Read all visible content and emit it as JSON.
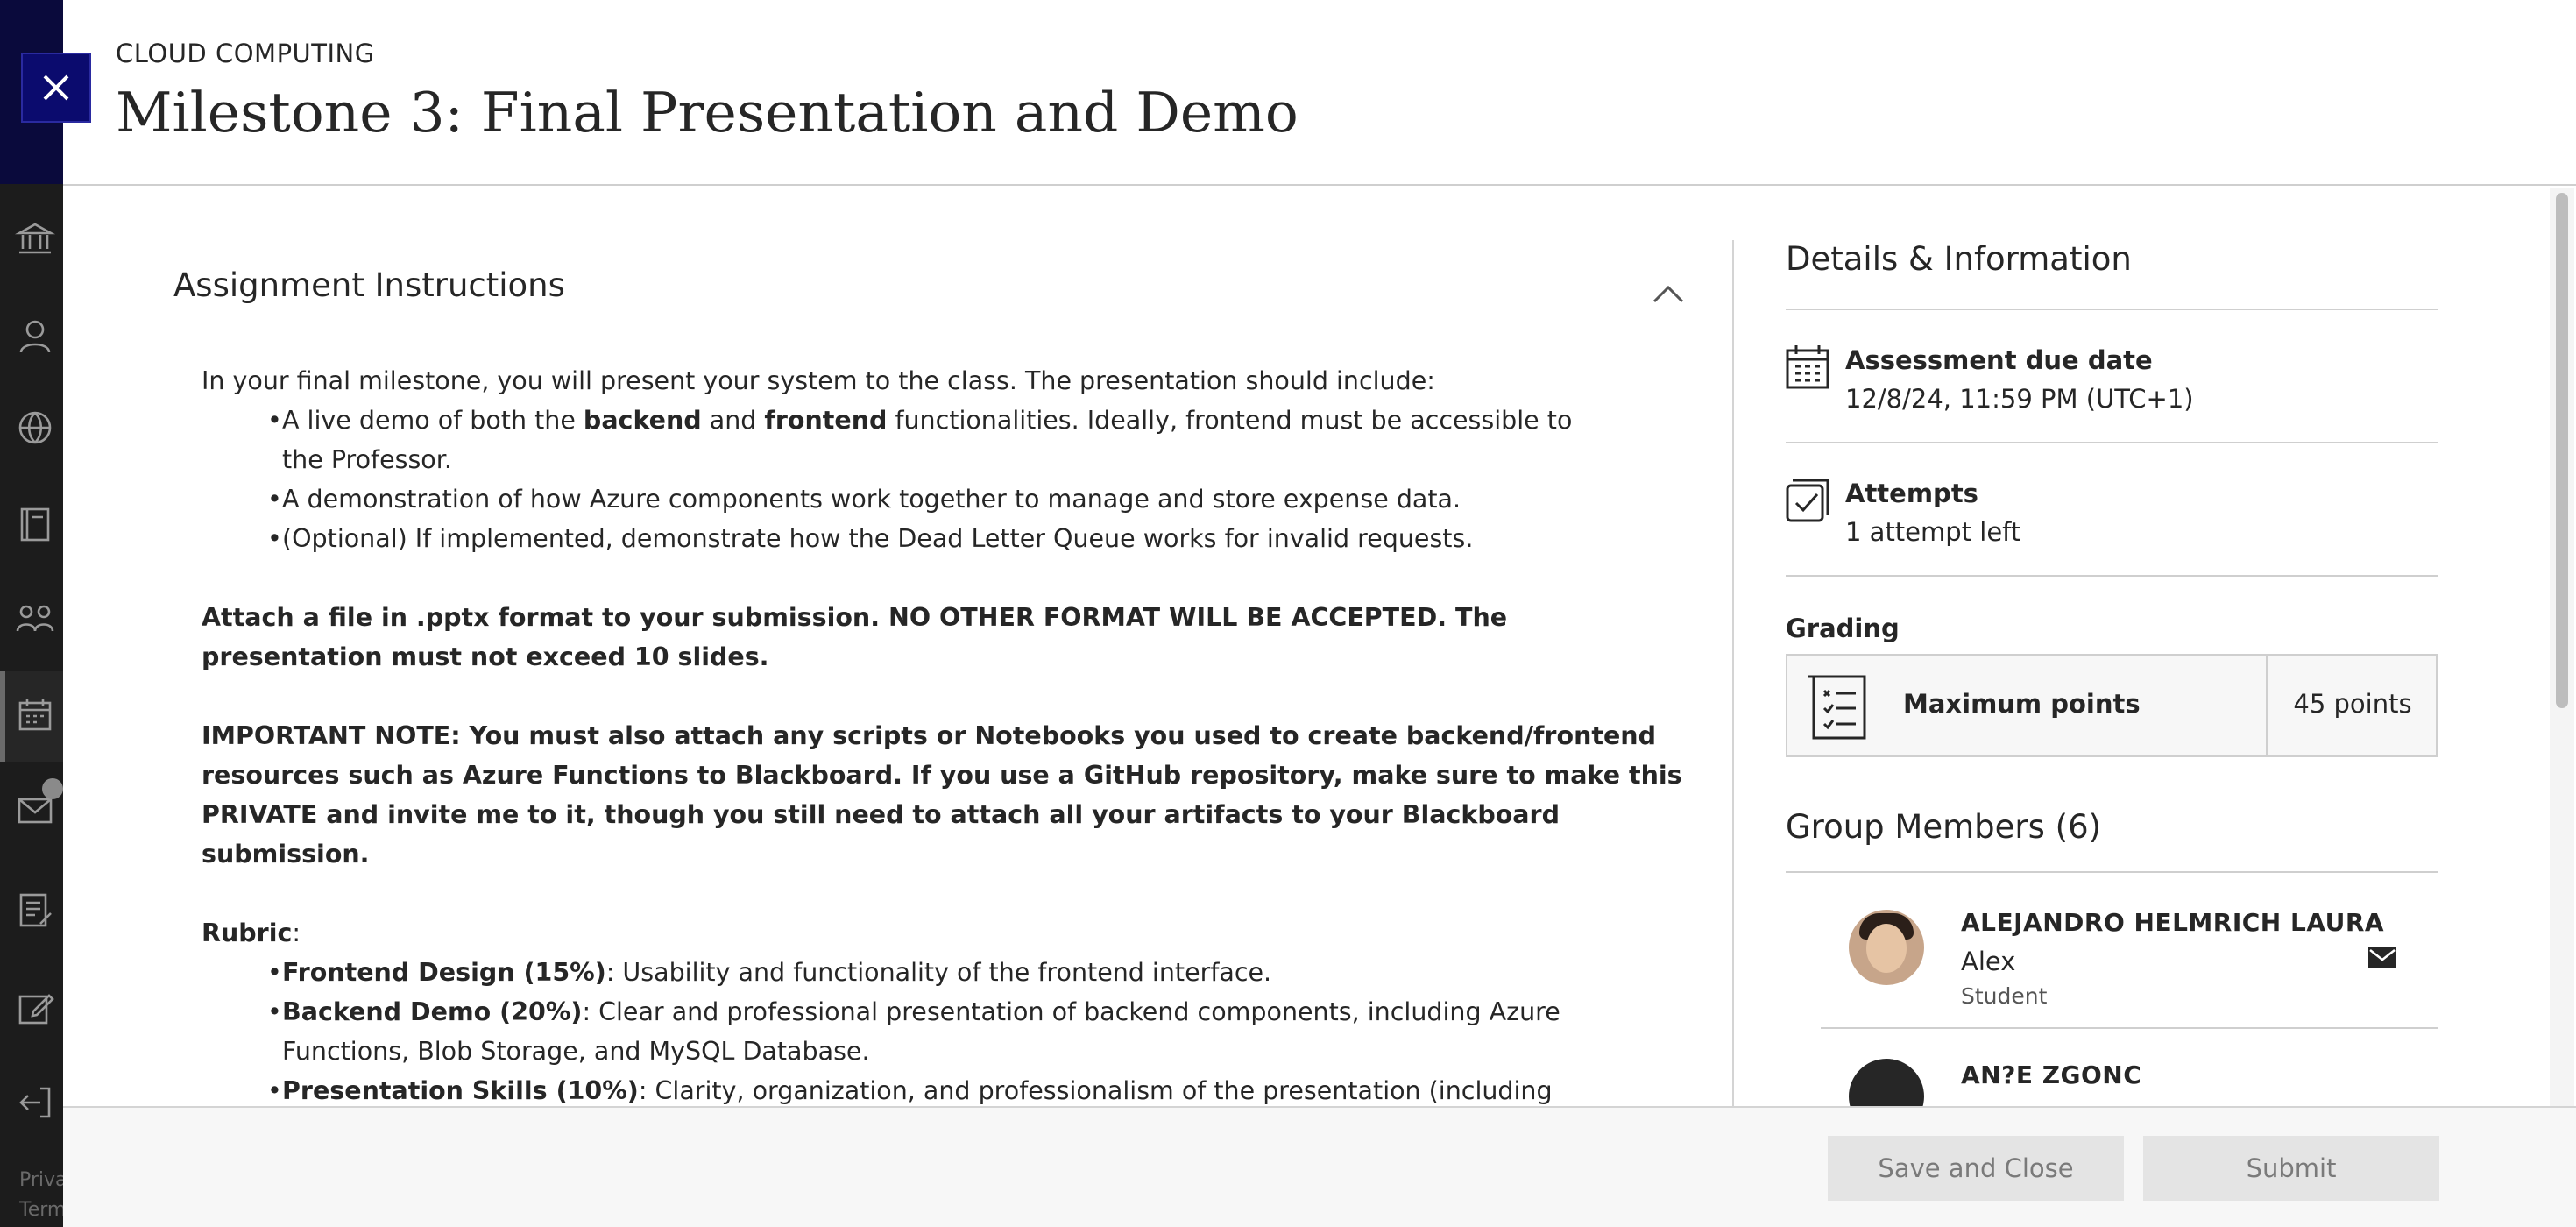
{
  "rail": {
    "icons": [
      "institution-icon",
      "profile-icon",
      "globe-icon",
      "courses-icon",
      "groups-icon",
      "calendar-icon",
      "messages-icon",
      "grades-icon",
      "edit-icon",
      "sign-out-icon"
    ],
    "badge_count": "",
    "footer_line1": "Privacy",
    "footer_line2": "Terms"
  },
  "header": {
    "course": "CLOUD COMPUTING",
    "title": "Milestone 3: Final Presentation and Demo"
  },
  "instructions": {
    "section_title": "Assignment Instructions",
    "intro": "In your final milestone, you will present your system to the class. The presentation should include:",
    "bullet1_a": "A live demo of both the ",
    "bullet1_b": "backend",
    "bullet1_c": " and ",
    "bullet1_d": "frontend",
    "bullet1_e": " functionalities. Ideally, frontend must be accessible to the Professor.",
    "bullet2": "A demonstration of how Azure components work together to manage and store expense data.",
    "bullet3": "(Optional) If implemented, demonstrate how the Dead Letter Queue works for invalid requests.",
    "attach_note": "Attach a file in .pptx format to your submission. NO OTHER FORMAT WILL BE ACCEPTED. The presentation must not exceed 10 slides.",
    "important_note": "IMPORTANT NOTE: You must also attach any scripts or Notebooks you used to create backend/frontend resources such as Azure Functions to Blackboard. If you use a GitHub repository, make sure to make this PRIVATE and invite me to it, though you still need to attach all your artifacts to your Blackboard submission.",
    "rubric_label": "Rubric",
    "rubric_colon": ":",
    "rubric": [
      {
        "name": "Frontend Design (15%)",
        "text": ": Usability and functionality of the frontend interface."
      },
      {
        "name": "Backend Demo (20%)",
        "text": ": Clear and professional presentation of backend components, including Azure Functions, Blob Storage, and MySQL Database."
      },
      {
        "name": "Presentation Skills (10%)",
        "text": ": Clarity, organization, and professionalism of the presentation (including presentation live delivery and quality of the visual artifacts used)."
      }
    ]
  },
  "details": {
    "title": "Details & Information",
    "due_label": "Assessment due date",
    "due_value": "12/8/24, 11:59 PM (UTC+1)",
    "attempts_label": "Attempts",
    "attempts_value": "1 attempt left",
    "grading_label": "Grading",
    "max_points_label": "Maximum points",
    "max_points_value": "45 points",
    "group_title": "Group Members (6)",
    "members": [
      {
        "name": "ALEJANDRO HELMRICH LAURA",
        "nickname": "Alex",
        "role": "Student"
      },
      {
        "name": "AN?E ZGONC",
        "nickname": "",
        "role": ""
      }
    ]
  },
  "footer": {
    "save_label": "Save and Close",
    "submit_label": "Submit"
  },
  "colors": {
    "rail_bg": "#1c1c1c",
    "rail_top": "#0a0a3c",
    "close_button": "#0b0b6e",
    "button_disabled": "#e4e4e4"
  }
}
